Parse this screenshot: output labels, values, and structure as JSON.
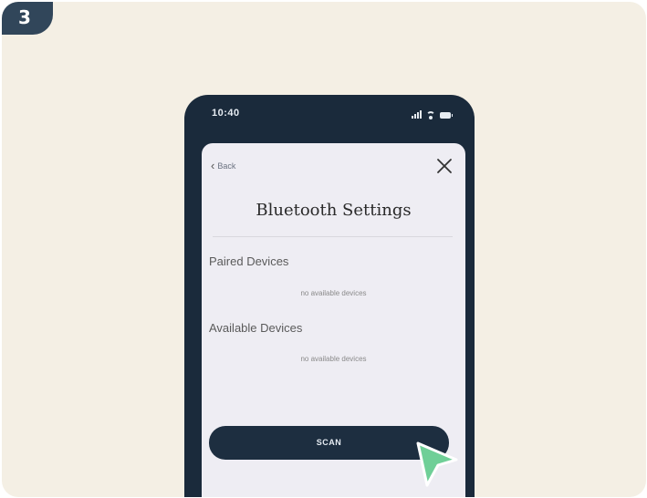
{
  "step": {
    "number": "3"
  },
  "phone": {
    "status_bar": {
      "time": "10:40",
      "icons": [
        "signal-icon",
        "wifi-icon",
        "battery-icon"
      ]
    },
    "header": {
      "back_label": "Back",
      "back_icon": "chevron-left-icon",
      "close_icon": "close-icon"
    },
    "title": "Bluetooth Settings",
    "sections": {
      "paired": {
        "label": "Paired Devices",
        "empty_text": "no available devices"
      },
      "available": {
        "label": "Available Devices",
        "empty_text": "no available devices"
      }
    },
    "scan_button": {
      "label": "SCAN"
    }
  },
  "pointer": {
    "icon": "cursor-arrow-icon",
    "color": "#6fcf97"
  },
  "colors": {
    "background": "#f4efe4",
    "badge": "#31465a",
    "phone_frame": "#1a2a3b",
    "screen": "#eeedf3",
    "button": "#1d2e40"
  }
}
